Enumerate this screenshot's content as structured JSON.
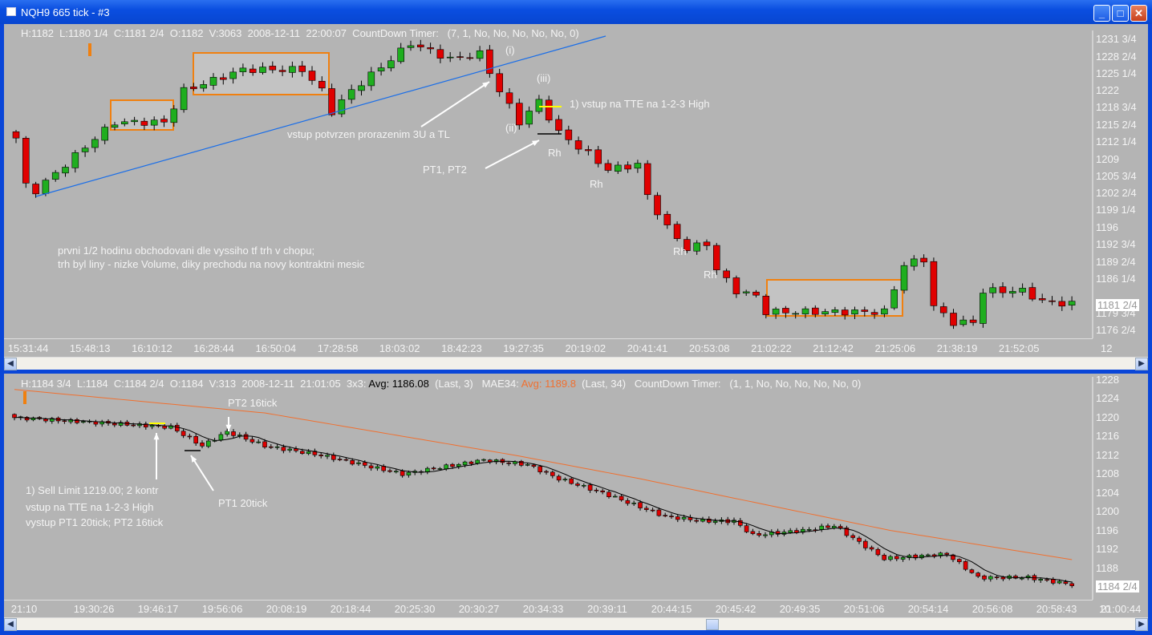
{
  "window": {
    "title": "NQH9  665 tick - #3",
    "minimize": "_",
    "maximize": "□",
    "close": "✕"
  },
  "top_pane": {
    "info": "H:1182  L:1180 1/4  C:1181 2/4  O:1182  V:3063  2008-12-11  22:00:07  CountDown Timer:   (7, 1, No, No, No, No, No, 0)",
    "price_labels": [
      "1231 3/4",
      "1228 2/4",
      "1225 1/4",
      "1222",
      "1218 3/4",
      "1215 2/4",
      "1212 1/4",
      "1209",
      "1205 3/4",
      "1202 2/4",
      "1199 1/4",
      "1196",
      "1192 3/4",
      "1189 2/4",
      "1186 1/4",
      "1179 3/4",
      "1176 2/4"
    ],
    "current_price": "1181 2/4",
    "time_labels": [
      "15:31:44",
      "15:48:13",
      "16:10:12",
      "16:28:44",
      "16:50:04",
      "17:28:58",
      "18:03:02",
      "18:42:23",
      "19:27:35",
      "20:19:02",
      "20:41:41",
      "20:53:08",
      "21:02:22",
      "21:12:42",
      "21:25:06",
      "21:38:19",
      "21:52:05"
    ],
    "axis_corner": "12",
    "annotations": {
      "wave_i": "(i)",
      "wave_iii": "(iii)",
      "wave_ii": "(ii)",
      "entry": "1) vstup na TTE na 1-2-3 High",
      "confirm": "vstup potvrzen prorazenim 3U a TL",
      "targets": "PT1, PT2",
      "rh1": "Rh",
      "rh2": "Rh",
      "rh3": "Rh",
      "rh4": "Rh",
      "note1": "prvni 1/2 hodinu obchodovani dle vyssiho tf trh v chopu;",
      "note2": "trh byl liny - nizke Volume, diky prechodu na novy kontraktni mesic"
    }
  },
  "bottom_pane": {
    "info_a": "H:1184 3/4  L:1184  C:1184 2/4  O:1184  V:313  2008-12-11  21:01:05  3x3: ",
    "avg3": "Avg: 1186.08",
    "info_b": "  (Last, 3)   MAE34: ",
    "avg34": "Avg: 1189.8",
    "info_c": "  (Last, 34)   CountDown Timer:   (1, 1, No, No, No, No, No, 0)",
    "price_labels": [
      "1228",
      "1224",
      "1220",
      "1216",
      "1212",
      "1208",
      "1204",
      "1200",
      "1196",
      "1192",
      "1188"
    ],
    "current_price": "1184 2/4",
    "time_labels": [
      "21:10",
      "19:30:26",
      "19:46:17",
      "19:56:06",
      "20:08:19",
      "20:18:44",
      "20:25:30",
      "20:30:27",
      "20:34:33",
      "20:39:11",
      "20:44:15",
      "20:45:42",
      "20:49:35",
      "20:51:06",
      "20:54:14",
      "20:56:08",
      "20:58:43",
      "21:00:44"
    ],
    "axis_corner": "10",
    "annotations": {
      "pt2": "PT2 16tick",
      "pt1": "PT1 20tick",
      "order1": "1) Sell Limit 1219.00; 2 kontr",
      "order2": "vstup na TTE na 1-2-3 High",
      "order3": "vystup PT1 20tick; PT2 16tick"
    }
  },
  "colors": {
    "background": "#b4b4b4",
    "up": "#1fae1f",
    "down": "#e00000",
    "box": "#f08010",
    "trendline": "#1a6ee8",
    "ma3": "#000000",
    "ma34": "#f07030",
    "entry_marker": "#ffff00"
  },
  "chart_data": [
    {
      "type": "candlestick",
      "title": "NQH9 665 tick",
      "candle_count": 108,
      "close_keypoints": [
        [
          0,
          1213
        ],
        [
          1,
          1204
        ],
        [
          2,
          1203
        ],
        [
          8,
          1213
        ],
        [
          10,
          1216
        ],
        [
          15,
          1216
        ],
        [
          17,
          1222
        ],
        [
          20,
          1224
        ],
        [
          23,
          1226
        ],
        [
          29,
          1226
        ],
        [
          31,
          1222
        ],
        [
          32,
          1218
        ],
        [
          34,
          1222
        ],
        [
          38,
          1228
        ],
        [
          40,
          1231
        ],
        [
          44,
          1228
        ],
        [
          47,
          1229
        ],
        [
          49,
          1222
        ],
        [
          51,
          1216
        ],
        [
          53,
          1220
        ],
        [
          55,
          1214
        ],
        [
          58,
          1210
        ],
        [
          60,
          1207
        ],
        [
          63,
          1208
        ],
        [
          64,
          1202
        ],
        [
          66,
          1196
        ],
        [
          68,
          1192
        ],
        [
          70,
          1193
        ],
        [
          71,
          1188
        ],
        [
          73,
          1184
        ],
        [
          75,
          1183
        ],
        [
          76,
          1180
        ],
        [
          88,
          1180
        ],
        [
          90,
          1189
        ],
        [
          92,
          1190
        ],
        [
          93,
          1181
        ],
        [
          95,
          1178
        ],
        [
          97,
          1178
        ],
        [
          98,
          1184
        ],
        [
          102,
          1184
        ],
        [
          104,
          1182
        ],
        [
          107,
          1181.5
        ]
      ],
      "ylim": [
        1176.5,
        1231.75
      ]
    },
    {
      "type": "candlestick",
      "title": "NQH9 3x3 with MA3 and MAE34",
      "candle_count": 170,
      "close_keypoints": [
        [
          0,
          1220
        ],
        [
          25,
          1218
        ],
        [
          30,
          1214
        ],
        [
          34,
          1217
        ],
        [
          40,
          1214
        ],
        [
          49,
          1212
        ],
        [
          62,
          1208
        ],
        [
          75,
          1211
        ],
        [
          82,
          1210
        ],
        [
          87,
          1207
        ],
        [
          94,
          1204
        ],
        [
          104,
          1199
        ],
        [
          110,
          1198
        ],
        [
          115,
          1198
        ],
        [
          118,
          1195
        ],
        [
          126,
          1196
        ],
        [
          131,
          1197
        ],
        [
          139,
          1190
        ],
        [
          149,
          1191
        ],
        [
          154,
          1186
        ],
        [
          162,
          1186
        ],
        [
          169,
          1184.5
        ]
      ],
      "mae34_keypoints": [
        [
          0,
          1226
        ],
        [
          40,
          1221
        ],
        [
          80,
          1212
        ],
        [
          100,
          1207
        ],
        [
          140,
          1196
        ],
        [
          169,
          1189.8
        ]
      ],
      "ylim": [
        1184,
        1228
      ]
    }
  ]
}
